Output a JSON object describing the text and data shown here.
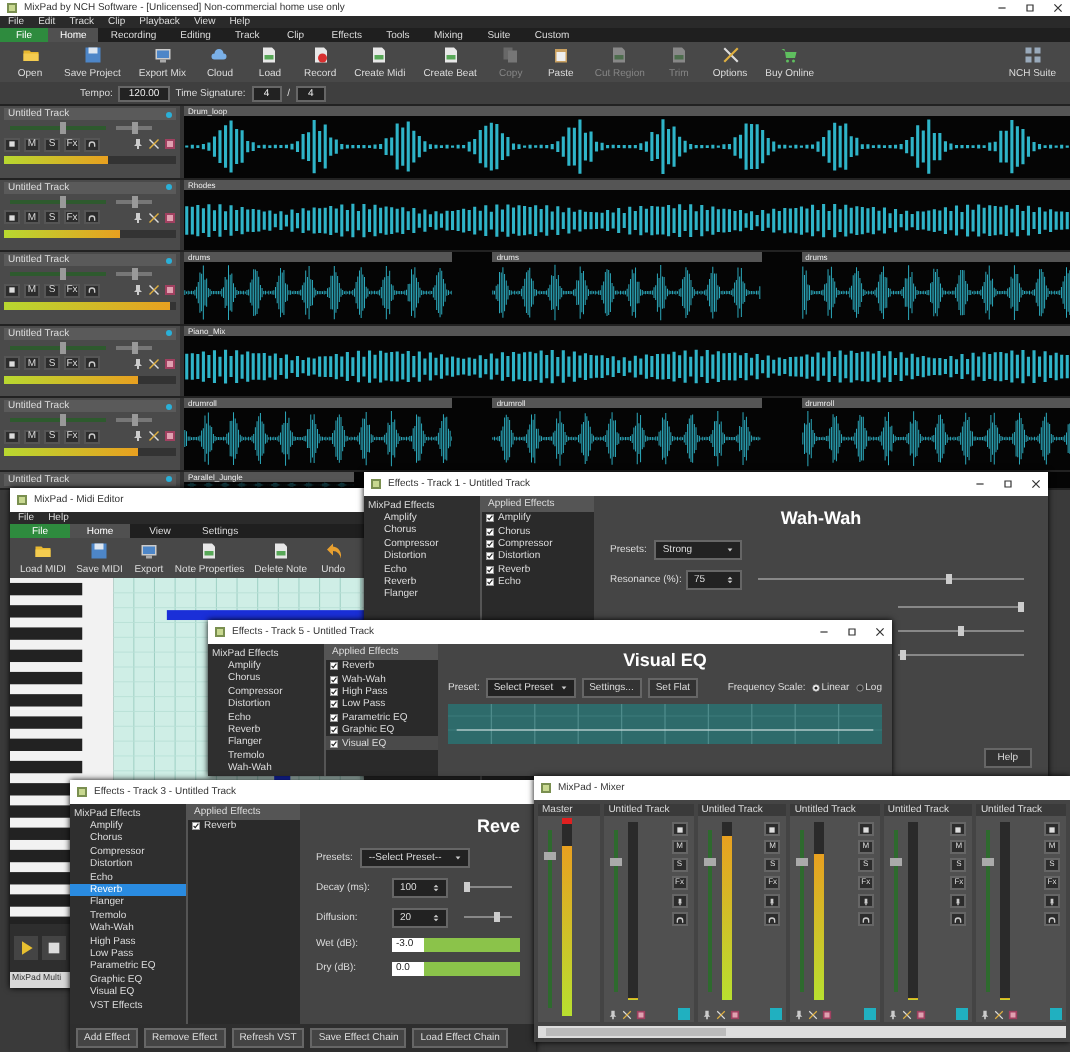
{
  "main_window": {
    "title": "MixPad by NCH Software - [Unlicensed] Non-commercial home use only",
    "menu": [
      "File",
      "Edit",
      "Track",
      "Clip",
      "Playback",
      "View",
      "Help"
    ],
    "ribbon_tabs": [
      {
        "label": "File",
        "kind": "file",
        "selected": false
      },
      {
        "label": "Home",
        "kind": "tab",
        "selected": true
      },
      {
        "label": "Recording",
        "kind": "tab",
        "selected": false
      },
      {
        "label": "Editing",
        "kind": "tab",
        "selected": false
      },
      {
        "label": "Track",
        "kind": "tab",
        "selected": false
      },
      {
        "label": "Clip",
        "kind": "tab",
        "selected": false
      },
      {
        "label": "Effects",
        "kind": "tab",
        "selected": false
      },
      {
        "label": "Tools",
        "kind": "tab",
        "selected": false
      },
      {
        "label": "Mixing",
        "kind": "tab",
        "selected": false
      },
      {
        "label": "Suite",
        "kind": "tab",
        "selected": false
      },
      {
        "label": "Custom",
        "kind": "tab",
        "selected": false
      }
    ],
    "toolbar": [
      {
        "label": "Open",
        "disabled": false
      },
      {
        "label": "Save Project",
        "disabled": false
      },
      {
        "label": "Export Mix",
        "disabled": false
      },
      {
        "label": "Cloud",
        "disabled": false
      },
      {
        "label": "Load",
        "disabled": false
      },
      {
        "label": "Record",
        "disabled": false
      },
      {
        "label": "Create Midi",
        "disabled": false
      },
      {
        "label": "Create Beat",
        "disabled": false
      },
      {
        "label": "Copy",
        "disabled": true
      },
      {
        "label": "Paste",
        "disabled": false
      },
      {
        "label": "Cut Region",
        "disabled": true
      },
      {
        "label": "Trim",
        "disabled": true
      },
      {
        "label": "Options",
        "disabled": false
      },
      {
        "label": "Buy Online",
        "disabled": false
      },
      {
        "label": "NCH Suite",
        "disabled": false
      }
    ],
    "tempo": {
      "label": "Tempo:",
      "value": "120.00"
    },
    "time_signature": {
      "label": "Time Signature:",
      "beats": "4",
      "separator": "/",
      "unit": "4"
    },
    "tracks": [
      {
        "name": "Untitled Track",
        "volume": {
          "level": 0.55
        },
        "pan": {
          "level": 0.5
        },
        "meter": {
          "level": 0.6
        },
        "buttons": [
          "M",
          "S",
          "Fx"
        ],
        "clips": [
          {
            "label": "Drum_loop"
          }
        ]
      },
      {
        "name": "Untitled Track",
        "volume": {
          "level": 0.55
        },
        "pan": {
          "level": 0.5
        },
        "meter": {
          "level": 0.68
        },
        "buttons": [
          "M",
          "S",
          "Fx"
        ],
        "clips": [
          {
            "label": "Rhodes"
          }
        ]
      },
      {
        "name": "Untitled Track",
        "volume": {
          "level": 0.55
        },
        "pan": {
          "level": 0.5
        },
        "meter": {
          "level": 0.96
        },
        "buttons": [
          "M",
          "S",
          "Fx"
        ],
        "clips": [
          {
            "label": "drums"
          },
          {
            "label": "drums"
          },
          {
            "label": "drums"
          }
        ]
      },
      {
        "name": "Untitled Track",
        "volume": {
          "level": 0.55
        },
        "pan": {
          "level": 0.5
        },
        "meter": {
          "level": 0.78
        },
        "buttons": [
          "M",
          "S",
          "Fx"
        ],
        "clips": [
          {
            "label": "Piano_Mix"
          }
        ]
      },
      {
        "name": "Untitled Track",
        "volume": {
          "level": 0.55
        },
        "pan": {
          "level": 0.5
        },
        "meter": {
          "level": 0.78
        },
        "buttons": [
          "M",
          "S",
          "Fx"
        ],
        "clips": [
          {
            "label": "drumroll"
          },
          {
            "label": "drumroll"
          },
          {
            "label": "drumroll"
          }
        ]
      },
      {
        "name": "Untitled Track",
        "clips": [
          {
            "label": "Parallel_Jungle"
          }
        ]
      }
    ]
  },
  "midi_editor": {
    "title": "MixPad - Midi Editor",
    "menu": [
      "File",
      "Help"
    ],
    "tabs": [
      {
        "label": "File",
        "kind": "file",
        "selected": false
      },
      {
        "label": "Home",
        "kind": "tab",
        "selected": true
      },
      {
        "label": "View",
        "kind": "tab",
        "selected": false
      },
      {
        "label": "Settings",
        "kind": "tab",
        "selected": false
      }
    ],
    "toolbar": [
      "Load MIDI",
      "Save MIDI",
      "Export",
      "Note Properties",
      "Delete Note",
      "Undo"
    ],
    "status": "MixPad Multi"
  },
  "effects_windows": [
    {
      "title": "Effects - Track 1 - Untitled Track",
      "window_controls": true,
      "effects_heading": "MixPad Effects",
      "applied_heading": "Applied Effects",
      "effects": [
        {
          "label": "Amplify",
          "selected": false
        },
        {
          "label": "Chorus",
          "selected": false
        },
        {
          "label": "Compressor",
          "selected": false
        },
        {
          "label": "Distortion",
          "selected": false
        },
        {
          "label": "Echo",
          "selected": false
        },
        {
          "label": "Reverb",
          "selected": false
        },
        {
          "label": "Flanger",
          "selected": false
        }
      ],
      "applied": [
        {
          "label": "Amplify",
          "checked": true,
          "selected": false
        },
        {
          "label": "Chorus",
          "checked": true,
          "selected": false
        },
        {
          "label": "Compressor",
          "checked": true,
          "selected": false
        },
        {
          "label": "Distortion",
          "checked": true,
          "selected": false
        },
        {
          "label": "Reverb",
          "checked": true,
          "selected": false
        },
        {
          "label": "Echo",
          "checked": true,
          "selected": false
        }
      ],
      "panel": {
        "kind": "wah",
        "heading": "Wah-Wah",
        "preset": {
          "label": "Presets:",
          "value": "Strong"
        },
        "sliders": [
          {
            "label": "Resonance (%):",
            "value": "75",
            "level": 0.72
          },
          {
            "level": 0.97
          },
          {
            "level": 0.5
          },
          {
            "level": 0.05
          }
        ],
        "help": "Help"
      }
    },
    {
      "title": "Effects - Track 5 - Untitled Track",
      "window_controls": true,
      "effects_heading": "MixPad Effects",
      "applied_heading": "Applied Effects",
      "effects": [
        {
          "label": "Amplify",
          "selected": false
        },
        {
          "label": "Chorus",
          "selected": false
        },
        {
          "label": "Compressor",
          "selected": false
        },
        {
          "label": "Distortion",
          "selected": false
        },
        {
          "label": "Echo",
          "selected": false
        },
        {
          "label": "Reverb",
          "selected": false
        },
        {
          "label": "Flanger",
          "selected": false
        },
        {
          "label": "Tremolo",
          "selected": false
        },
        {
          "label": "Wah-Wah",
          "selected": false
        }
      ],
      "applied": [
        {
          "label": "Reverb",
          "checked": true,
          "selected": false
        },
        {
          "label": "Wah-Wah",
          "checked": true,
          "selected": false
        },
        {
          "label": "High Pass",
          "checked": true,
          "selected": false
        },
        {
          "label": "Low Pass",
          "checked": true,
          "selected": false
        },
        {
          "label": "Parametric EQ",
          "checked": true,
          "selected": false
        },
        {
          "label": "Graphic EQ",
          "checked": true,
          "selected": false
        },
        {
          "label": "Visual EQ",
          "checked": true,
          "selected": true
        }
      ],
      "panel": {
        "kind": "eq",
        "heading": "Visual EQ",
        "preset": {
          "label": "Preset:",
          "value": "Select Preset"
        },
        "buttons": [
          "Settings...",
          "Set Flat"
        ],
        "scale": {
          "label": "Frequency Scale:",
          "options": [
            {
              "label": "Linear",
              "selected": true
            },
            {
              "label": "Log",
              "selected": false
            }
          ]
        }
      }
    },
    {
      "title": "Effects - Track 3 - Untitled Track",
      "window_controls": false,
      "effects_heading": "MixPad Effects",
      "applied_heading": "Applied Effects",
      "effects": [
        {
          "label": "Amplify",
          "selected": false
        },
        {
          "label": "Chorus",
          "selected": false
        },
        {
          "label": "Compressor",
          "selected": false
        },
        {
          "label": "Distortion",
          "selected": false
        },
        {
          "label": "Echo",
          "selected": false
        },
        {
          "label": "Reverb",
          "selected": true
        },
        {
          "label": "Flanger",
          "selected": false
        },
        {
          "label": "Tremolo",
          "selected": false
        },
        {
          "label": "Wah-Wah",
          "selected": false
        },
        {
          "label": "High Pass",
          "selected": false
        },
        {
          "label": "Low Pass",
          "selected": false
        },
        {
          "label": "Parametric EQ",
          "selected": false
        },
        {
          "label": "Graphic EQ",
          "selected": false
        },
        {
          "label": "Visual EQ",
          "selected": false
        },
        {
          "label": "VST Effects",
          "selected": false
        }
      ],
      "applied": [
        {
          "label": "Reverb",
          "checked": true,
          "selected": false
        }
      ],
      "panel": {
        "kind": "reverb",
        "heading": "Reve",
        "preset": {
          "label": "Presets:",
          "value": "--Select Preset--"
        },
        "sliders": [
          {
            "label": "Decay (ms):",
            "value": "100",
            "level": 0.05
          },
          {
            "label": "Diffusion:",
            "value": "20",
            "level": 0.7
          }
        ],
        "bars": [
          {
            "label": "Wet (dB):",
            "value": "-3.0",
            "level": 1
          },
          {
            "label": "Dry (dB):",
            "value": "0.0",
            "level": 1
          }
        ]
      },
      "buttons": [
        "Add Effect",
        "Remove Effect",
        "Refresh VST",
        "Save Effect Chain",
        "Load Effect Chain"
      ]
    }
  ],
  "mixer": {
    "title": "MixPad - Mixer",
    "channels": [
      {
        "name": "Master",
        "kind": "master",
        "fader": {
          "level": 0.85
        },
        "meter": {
          "level": 0.88
        }
      },
      {
        "name": "Untitled Track",
        "kind": "track",
        "fader": {
          "level": 0.8
        },
        "meter": {
          "level": 0
        },
        "buttons": [
          "M",
          "S",
          "Fx"
        ]
      },
      {
        "name": "Untitled Track",
        "kind": "track",
        "fader": {
          "level": 0.8
        },
        "meter": {
          "level": 0.92
        },
        "buttons": [
          "M",
          "S",
          "Fx"
        ]
      },
      {
        "name": "Untitled Track",
        "kind": "track",
        "fader": {
          "level": 0.8
        },
        "meter": {
          "level": 0.82
        },
        "buttons": [
          "M",
          "S",
          "Fx"
        ]
      },
      {
        "name": "Untitled Track",
        "kind": "track",
        "fader": {
          "level": 0.8
        },
        "meter": {
          "level": 0
        },
        "buttons": [
          "M",
          "S",
          "Fx"
        ]
      },
      {
        "name": "Untitled Track",
        "kind": "track",
        "fader": {
          "level": 0.8
        },
        "meter": {
          "level": 0
        },
        "buttons": [
          "M",
          "S",
          "Fx"
        ]
      }
    ]
  }
}
